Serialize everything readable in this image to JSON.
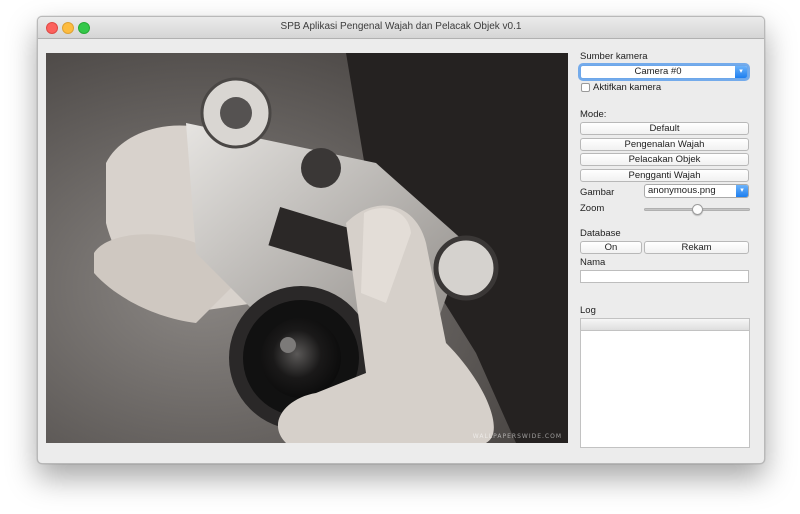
{
  "window": {
    "title": "SPB Aplikasi Pengenal Wajah dan Pelacak Objek v0.1"
  },
  "viewport": {
    "watermark": "WALLPAPERSWIDE.COM"
  },
  "camera": {
    "section_label": "Sumber kamera",
    "selected": "Camera #0",
    "activate_label": "Aktifkan kamera",
    "activate_checked": false
  },
  "mode": {
    "section_label": "Mode:",
    "buttons": [
      "Default",
      "Pengenalan Wajah",
      "Pelacakan Objek",
      "Pengganti Wajah"
    ],
    "image_label": "Gambar",
    "image_selected": "anonymous.png",
    "zoom_label": "Zoom",
    "zoom_value": 0.5
  },
  "database": {
    "section_label": "Database",
    "on_label": "On",
    "record_label": "Rekam",
    "name_label": "Nama",
    "name_value": ""
  },
  "log": {
    "section_label": "Log"
  },
  "colors": {
    "accent": "#1d7ff0",
    "window_bg": "#ececec"
  }
}
